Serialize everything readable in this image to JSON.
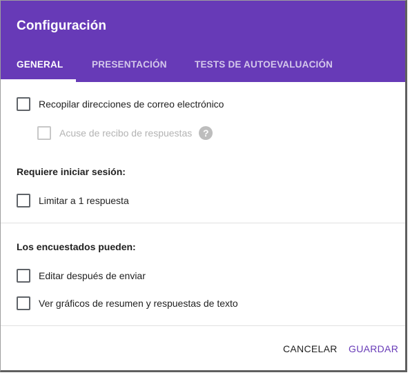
{
  "dialog": {
    "title": "Configuración",
    "tabs": [
      {
        "label": "GENERAL",
        "active": true
      },
      {
        "label": "PRESENTACIÓN",
        "active": false
      },
      {
        "label": "TESTS DE AUTOEVALUACIÓN",
        "active": false
      }
    ]
  },
  "general": {
    "collect_emails": {
      "label": "Recopilar direcciones de correo electrónico",
      "checked": false
    },
    "response_receipts": {
      "label": "Acuse de recibo de respuestas",
      "checked": false,
      "disabled": true,
      "help_icon": "help-icon"
    },
    "sign_in_heading": "Requiere iniciar sesión:",
    "limit_one": {
      "label": "Limitar a 1 respuesta",
      "checked": false
    },
    "respondents_heading": "Los encuestados pueden:",
    "edit_after": {
      "label": "Editar después de enviar",
      "checked": false
    },
    "see_summary": {
      "label": "Ver gráficos de resumen y respuestas de texto",
      "checked": false
    }
  },
  "actions": {
    "cancel_label": "CANCELAR",
    "save_label": "GUARDAR"
  },
  "colors": {
    "header": "#673ab7",
    "primary": "#673ab7"
  }
}
